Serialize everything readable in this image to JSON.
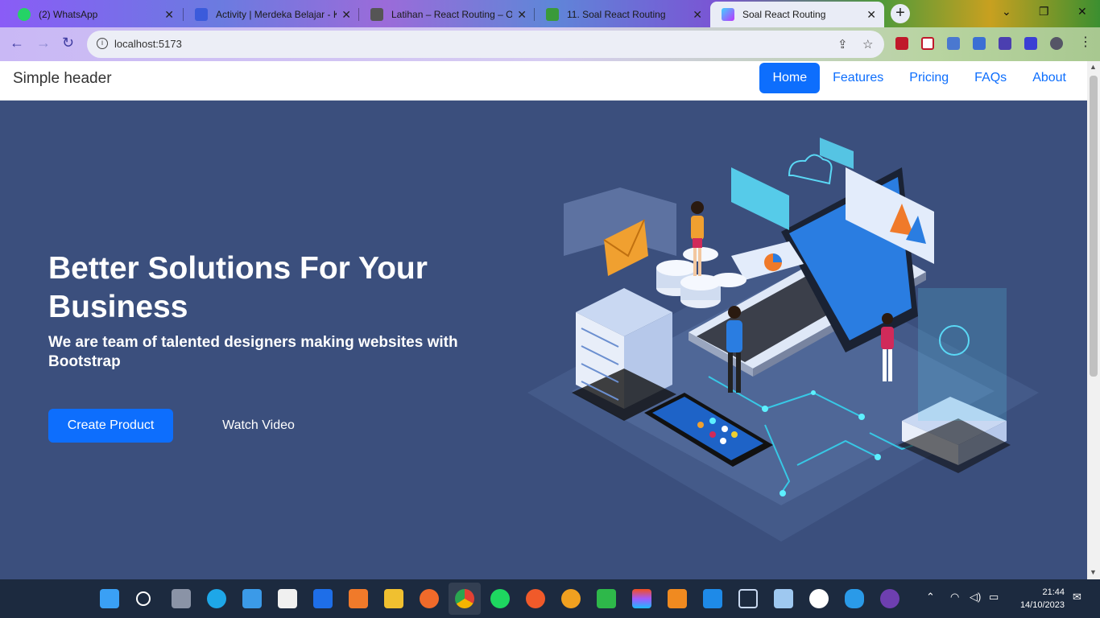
{
  "browser": {
    "tabs": [
      {
        "title": "(2) WhatsApp",
        "icon": "whatsapp-icon",
        "color": "#25d366"
      },
      {
        "title": "Activity | Merdeka Belajar - K",
        "icon": "kampus-merdeka-icon",
        "color": "#3b5bdb"
      },
      {
        "title": "Latihan – React Routing – O",
        "icon": "one-icon",
        "color": "#555555"
      },
      {
        "title": "11. Soal React Routing",
        "icon": "book-icon",
        "color": "#3a9a3a"
      },
      {
        "title": "Soal React Routing",
        "icon": "vite-icon",
        "color": "#8a5cf6"
      }
    ],
    "new_tab": "+",
    "url": "localhost:5173"
  },
  "header": {
    "brand": "Simple header",
    "nav": [
      "Home",
      "Features",
      "Pricing",
      "FAQs",
      "About"
    ]
  },
  "hero": {
    "title": "Better Solutions For Your Business",
    "subtitle": "We are team of talented designers making websites with Bootstrap",
    "primary_button": "Create Product",
    "secondary_button": "Watch Video"
  },
  "taskbar": {
    "time": "21:44",
    "date": "14/10/2023"
  },
  "colors": {
    "hero_bg": "#3b4f7d",
    "primary": "#0d6efd",
    "taskbar_bg": "#1c2a3f"
  }
}
